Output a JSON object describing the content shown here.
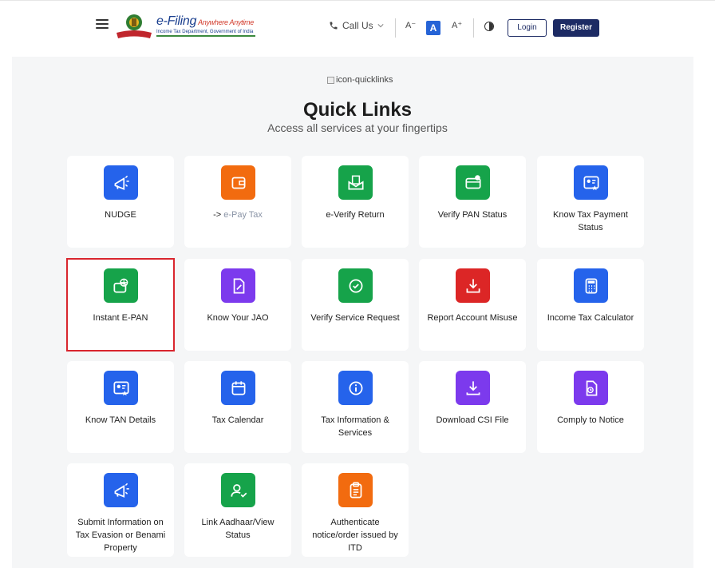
{
  "header": {
    "brand_main": "e-Filing",
    "brand_tag": "Anywhere Anytime",
    "brand_sub": "Income Tax Department, Government of India",
    "call_us": "Call Us",
    "font_small": "A⁻",
    "font_normal": "A",
    "font_large": "A⁺",
    "login": "Login",
    "register": "Register"
  },
  "main": {
    "image_alt": "icon-quicklinks",
    "title": "Quick Links",
    "subtitle": "Access all services at your fingertips"
  },
  "cards": [
    {
      "id": "nudge",
      "label": "NUDGE",
      "color": "#2563eb",
      "icon": "megaphone-icon"
    },
    {
      "id": "epay",
      "label_prefix": "-> ",
      "label_muted": "e-Pay Tax",
      "color": "#f26b0f",
      "icon": "wallet-icon"
    },
    {
      "id": "everify",
      "label": "e-Verify Return",
      "color": "#16a34a",
      "icon": "envelope-doc-icon"
    },
    {
      "id": "verify-pan",
      "label": "Verify PAN Status",
      "color": "#16a34a",
      "icon": "card-check-icon"
    },
    {
      "id": "tax-payment",
      "label": "Know Tax Payment Status",
      "color": "#2563eb",
      "icon": "id-card-star-icon"
    },
    {
      "id": "instant-epan",
      "label": "Instant E-PAN",
      "color": "#16a34a",
      "icon": "card-globe-icon"
    },
    {
      "id": "jao",
      "label": "Know Your JAO",
      "color": "#7c3aed",
      "icon": "document-edit-icon"
    },
    {
      "id": "service-request",
      "label": "Verify Service Request",
      "color": "#16a34a",
      "icon": "check-badge-icon"
    },
    {
      "id": "report-misuse",
      "label": "Report Account Misuse",
      "color": "#dc2626",
      "icon": "download-tray-icon"
    },
    {
      "id": "calculator",
      "label": "Income Tax Calculator",
      "color": "#2563eb",
      "icon": "calculator-icon"
    },
    {
      "id": "tan",
      "label": "Know TAN Details",
      "color": "#2563eb",
      "icon": "id-card-star-icon"
    },
    {
      "id": "calendar",
      "label": "Tax Calendar",
      "color": "#2563eb",
      "icon": "calendar-icon"
    },
    {
      "id": "tax-info",
      "label": "Tax Information & Services",
      "color": "#2563eb",
      "icon": "info-icon"
    },
    {
      "id": "csi",
      "label": "Download CSI File",
      "color": "#7c3aed",
      "icon": "download-icon"
    },
    {
      "id": "comply",
      "label": "Comply to Notice",
      "color": "#7c3aed",
      "icon": "document-clock-icon"
    },
    {
      "id": "tax-evasion",
      "label": "Submit Information on Tax Evasion or Benami Property",
      "color": "#2563eb",
      "icon": "megaphone-icon"
    },
    {
      "id": "aadhaar",
      "label": "Link Aadhaar/View Status",
      "color": "#16a34a",
      "icon": "user-check-icon"
    },
    {
      "id": "authenticate",
      "label": "Authenticate notice/order issued by ITD",
      "color": "#f26b0f",
      "icon": "clipboard-icon"
    }
  ],
  "highlighted_card": "instant-epan"
}
